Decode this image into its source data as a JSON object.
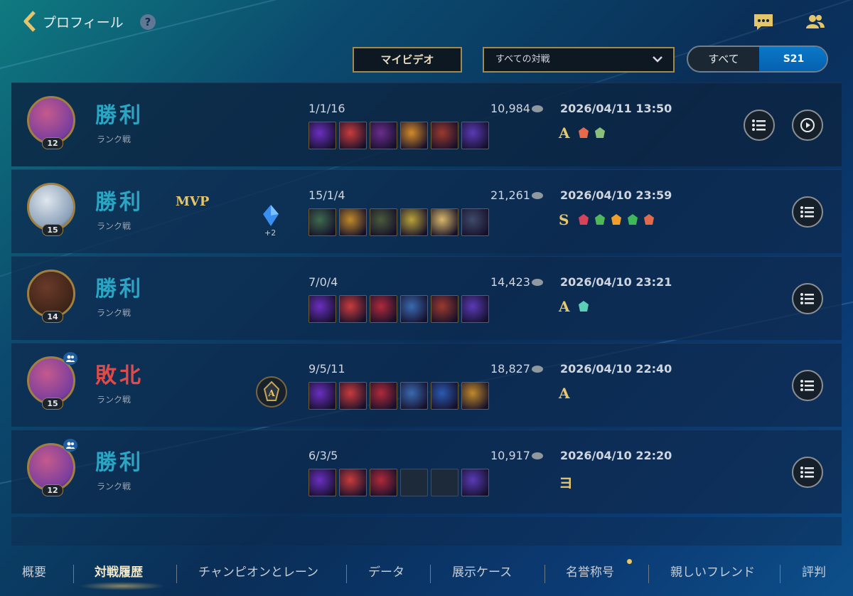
{
  "header": {
    "title": "プロフィール",
    "help": "?"
  },
  "filters": {
    "my_video_label": "マイビデオ",
    "match_filter_value": "すべての対戦",
    "segment_all": "すべて",
    "segment_season": "S21"
  },
  "matches": [
    {
      "result": "勝利",
      "outcome": "win",
      "mode": "ランク戦",
      "level": "12",
      "kda": "1/1/16",
      "gold": "10,984",
      "date": "2026/04/11",
      "time": "13:50",
      "grade": "A",
      "mvp": "",
      "crystal_count": "",
      "party": false,
      "items": [
        "#6b2fc0",
        "#c83c3c",
        "#6a2d8c",
        "#d38a2a",
        "#9b3a2e",
        "#5a3ab5"
      ],
      "medals": [
        "#e76a4a",
        "#8ac07a"
      ],
      "replay": true
    },
    {
      "result": "勝利",
      "outcome": "win",
      "mode": "ランク戦",
      "level": "15",
      "kda": "15/1/4",
      "gold": "21,261",
      "date": "2026/04/10",
      "time": "23:59",
      "grade": "S",
      "mvp": "MVP",
      "crystal_count": "+2",
      "party": false,
      "items": [
        "#3f6a4e",
        "#c08a2a",
        "#4a5a3a",
        "#b9a23a",
        "#d8b86a",
        "#3f4a6a"
      ],
      "medals": [
        "#d9435a",
        "#4fb95a",
        "#f0a02a",
        "#3fb85a",
        "#e26a4a"
      ],
      "replay": false
    },
    {
      "result": "勝利",
      "outcome": "win",
      "mode": "ランク戦",
      "level": "14",
      "kda": "7/0/4",
      "gold": "14,423",
      "date": "2026/04/10",
      "time": "23:21",
      "grade": "A",
      "mvp": "",
      "crystal_count": "",
      "party": false,
      "items": [
        "#6b2fc0",
        "#c83c3c",
        "#b02a3a",
        "#3a6ab0",
        "#9b3a2e",
        "#5a3ab5"
      ],
      "medals": [
        "#5ad0b8"
      ],
      "replay": false
    },
    {
      "result": "敗北",
      "outcome": "lose",
      "mode": "ランク戦",
      "level": "15",
      "kda": "9/5/11",
      "gold": "18,827",
      "date": "2026/04/10",
      "time": "22:40",
      "grade": "A",
      "mvp": "",
      "crystal_count": "",
      "party": true,
      "items": [
        "#6b2fc0",
        "#c83c3c",
        "#b02a3a",
        "#3a6ab0",
        "#2a5ab0",
        "#c08a2a"
      ],
      "medals": [],
      "replay": false,
      "rank_badge": "A"
    },
    {
      "result": "勝利",
      "outcome": "win",
      "mode": "ランク戦",
      "level": "12",
      "kda": "6/3/5",
      "gold": "10,917",
      "date": "2026/04/10",
      "time": "22:20",
      "grade": "ヨ",
      "mvp": "",
      "crystal_count": "",
      "party": true,
      "items": [
        "#6b2fc0",
        "#c83c3c",
        "#b02a3a",
        "",
        "",
        "#5a3ab5"
      ],
      "medals": [],
      "replay": false
    }
  ],
  "nav": {
    "tabs": [
      "概要",
      "対戦履歴",
      "チャンピオンとレーン",
      "データ",
      "展示ケース",
      "名誉称号",
      "親しいフレンド",
      "評判"
    ],
    "active": "対戦履歴"
  },
  "colors": {
    "win": "#2aa5c4",
    "lose": "#e04a48",
    "gold_accent": "#e7c66c",
    "active_segment": "#0a78c8"
  }
}
